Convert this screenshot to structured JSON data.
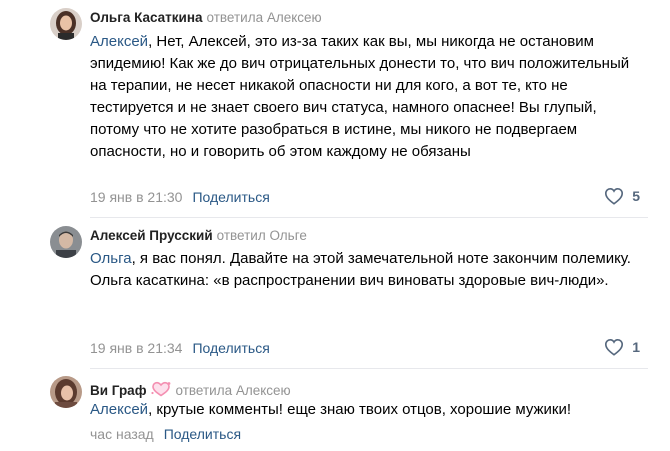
{
  "comments": [
    {
      "author": "Ольга Касаткина",
      "replied_to": "ответила Алексею",
      "mention": "Алексей",
      "text": ", Нет, Алексей, это из-за таких как вы, мы никогда не остановим эпидемию! Как же до вич отрицательных донести то, что вич положительный на терапии, не несет никакой опасности ни для кого, а вот те, кто не тестируется и не знает своего вич статуса, намного опаснее! Вы глупый, потому что не хотите разобраться в истине, мы никого не подвергаем опасности, но и говорить об этом каждому не обязаны",
      "time": "19 янв в 21:30",
      "share_label": "Поделиться",
      "likes": "5"
    },
    {
      "author": "Алексей Прусский",
      "replied_to": "ответил Ольге",
      "mention": "Ольга",
      "text_line1": ", я вас понял. Давайте на этой замечательной ноте закончим полемику.",
      "text_line2": "Ольга касаткина: «в распространении вич виноваты здоровые вич-люди».",
      "time": "19 янв в 21:34",
      "share_label": "Поделиться",
      "likes": "1"
    },
    {
      "author": "Ви Граф",
      "replied_to": "ответила Алексею",
      "mention": "Алексей",
      "text": ", крутые комменты! еще знаю твоих отцов, хорошие мужики!",
      "time": "час назад",
      "share_label": "Поделиться"
    }
  ],
  "colors": {
    "link": "#2a5885",
    "muted": "#939393",
    "like_icon": "#55677d",
    "badge": "#f48fb1"
  },
  "icons": {
    "like": "heart-outline-icon",
    "badge": "heart-badge-icon"
  }
}
